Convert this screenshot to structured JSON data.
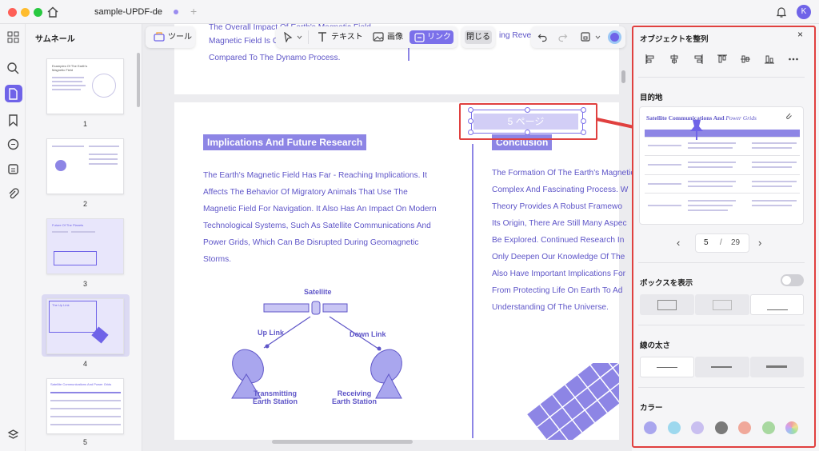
{
  "window": {
    "tab_title": "sample-UPDF-de",
    "tab_add": "+",
    "avatar_letter": "K"
  },
  "thumbnails": {
    "title": "サムネール",
    "pages": [
      {
        "number": "1",
        "caption": "Examples Of The Earth's Magnetic Field"
      },
      {
        "number": "2",
        "caption": ""
      },
      {
        "number": "3",
        "caption": "Future Of The Planets"
      },
      {
        "number": "4",
        "caption": "The Up Link"
      },
      {
        "number": "5",
        "caption": "Satellite Communications And Power Grids"
      }
    ],
    "partial_number": "5"
  },
  "toolbar": {
    "tools_label": "ツール",
    "text_label": "テキスト",
    "image_label": "画像",
    "link_label": "リンク",
    "close_label": "閉じる"
  },
  "document": {
    "prev_page_lines": [
      "The Overall Impact Of Earth's Magnetic Field",
      "Magnetic Field Is Co",
      "Compared To The Dynamo Process."
    ],
    "prev_page_right": "ing Revers",
    "left_heading": "Implications And Future Research",
    "left_paragraph": [
      "The Earth's Magnetic Field Has Far - Reaching Implications. It",
      "Affects The Behavior Of Migratory Animals That Use The",
      "Magnetic Field For Navigation. It Also Has An Impact On Modern",
      "Technological Systems, Such As Satellite Communications And",
      "Power Grids, Which Can Be Disrupted During Geomagnetic",
      "Storms."
    ],
    "right_heading": "Conclusion",
    "right_paragraph": [
      "The Formation Of The Earth's Magnetic",
      "Complex And Fascinating Process. W",
      "Theory Provides A Robust Framewo",
      "Its Origin, There Are Still Many Aspec",
      "Be Explored. Continued Research In",
      "Only Deepen Our Knowledge Of The",
      "Also Have Important Implications For",
      "From Protecting Life On Earth To Ad",
      "Understanding Of The Universe."
    ],
    "diagram": {
      "satellite": "Satellite",
      "uplink": "Up Link",
      "downlink": "Down Link",
      "transmitting": [
        "Transmitting",
        "Earth Station"
      ],
      "receiving": [
        "Receiving",
        "Earth Station"
      ]
    },
    "link_box_text": "5 ページ"
  },
  "panel": {
    "align_title": "オブジェクトを整列",
    "destination_title": "目的地",
    "preview": {
      "title_bold": "Satellite Communications And",
      "title_italic": "Power Grids"
    },
    "page_current": "5",
    "page_sep": "/",
    "page_total": "29",
    "show_box_label": "ボックスを表示",
    "line_width_label": "線の太さ",
    "color_label": "カラー",
    "colors": [
      "#a9a6ee",
      "#9dd8ee",
      "#c9bff0",
      "#7a7a7a",
      "#f0a89a",
      "#a8d8a0",
      "#e0a0d0"
    ]
  }
}
